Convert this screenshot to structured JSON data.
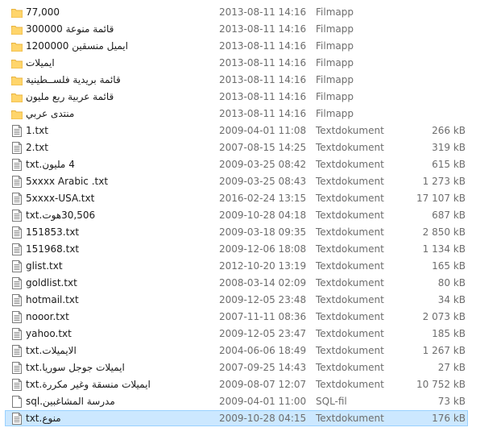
{
  "files": [
    {
      "name": "77,000",
      "date": "2013-08-11 14:16",
      "type": "Filmapp",
      "size": "",
      "icon": "folder-icon"
    },
    {
      "name": "قائمة منوعة 300000",
      "date": "2013-08-11 14:16",
      "type": "Filmapp",
      "size": "",
      "icon": "folder-icon"
    },
    {
      "name": "ايميل منسقين 1200000",
      "date": "2013-08-11 14:16",
      "type": "Filmapp",
      "size": "",
      "icon": "folder-icon"
    },
    {
      "name": "ايميلات",
      "date": "2013-08-11 14:16",
      "type": "Filmapp",
      "size": "",
      "icon": "folder-icon"
    },
    {
      "name": "قائمة بريدية فلســطينية",
      "date": "2013-08-11 14:16",
      "type": "Filmapp",
      "size": "",
      "icon": "folder-icon"
    },
    {
      "name": "قائمة عربية ربع مليون",
      "date": "2013-08-11 14:16",
      "type": "Filmapp",
      "size": "",
      "icon": "folder-icon"
    },
    {
      "name": "منتدى عربي",
      "date": "2013-08-11 14:16",
      "type": "Filmapp",
      "size": "",
      "icon": "folder-icon"
    },
    {
      "name": "1.txt",
      "date": "2009-04-01 11:08",
      "type": "Textdokument",
      "size": "266 kB",
      "icon": "text-file-icon"
    },
    {
      "name": "2.txt",
      "date": "2007-08-15 14:25",
      "type": "Textdokument",
      "size": "319 kB",
      "icon": "text-file-icon"
    },
    {
      "name": "4 مليون.txt",
      "date": "2009-03-25 08:42",
      "type": "Textdokument",
      "size": "615 kB",
      "icon": "text-file-icon"
    },
    {
      "name": "5xxxx Arabic .txt",
      "date": "2009-03-25 08:43",
      "type": "Textdokument",
      "size": "1 273 kB",
      "icon": "text-file-icon"
    },
    {
      "name": "5xxxx-USA.txt",
      "date": "2016-02-24 13:15",
      "type": "Textdokument",
      "size": "17 107 kB",
      "icon": "text-file-icon"
    },
    {
      "name": "30,506هوت.txt",
      "date": "2009-10-28 04:18",
      "type": "Textdokument",
      "size": "687 kB",
      "icon": "text-file-icon"
    },
    {
      "name": "151853.txt",
      "date": "2009-03-18 09:35",
      "type": "Textdokument",
      "size": "2 850 kB",
      "icon": "text-file-icon"
    },
    {
      "name": "151968.txt",
      "date": "2009-12-06 18:08",
      "type": "Textdokument",
      "size": "1 134 kB",
      "icon": "text-file-icon"
    },
    {
      "name": "glist.txt",
      "date": "2012-10-20 13:19",
      "type": "Textdokument",
      "size": "165 kB",
      "icon": "text-file-icon"
    },
    {
      "name": "goldlist.txt",
      "date": "2008-03-14 02:09",
      "type": "Textdokument",
      "size": "80 kB",
      "icon": "text-file-icon"
    },
    {
      "name": "hotmail.txt",
      "date": "2009-12-05 23:48",
      "type": "Textdokument",
      "size": "34 kB",
      "icon": "text-file-icon"
    },
    {
      "name": "nooor.txt",
      "date": "2007-11-11 08:36",
      "type": "Textdokument",
      "size": "2 073 kB",
      "icon": "text-file-icon"
    },
    {
      "name": "yahoo.txt",
      "date": "2009-12-05 23:47",
      "type": "Textdokument",
      "size": "185 kB",
      "icon": "text-file-icon"
    },
    {
      "name": "الايميلات.txt",
      "date": "2004-06-06 18:49",
      "type": "Textdokument",
      "size": "1 267 kB",
      "icon": "text-file-icon"
    },
    {
      "name": "ايميلات جوجل سوريا.txt",
      "date": "2007-09-25 14:43",
      "type": "Textdokument",
      "size": "27 kB",
      "icon": "text-file-icon"
    },
    {
      "name": "ايميلات منسقة وغير مكررة.txt",
      "date": "2009-08-07 12:07",
      "type": "Textdokument",
      "size": "10 752 kB",
      "icon": "text-file-icon"
    },
    {
      "name": "مدرسة المشاغبين.sql",
      "date": "2009-04-01 11:00",
      "type": "SQL-fil",
      "size": "73 kB",
      "icon": "sql-file-icon"
    },
    {
      "name": "منوع.txt",
      "date": "2009-10-28 04:15",
      "type": "Textdokument",
      "size": "176 kB",
      "icon": "text-file-icon",
      "selected": true
    }
  ],
  "colors": {
    "folder": "#ffd56b",
    "folder_dark": "#e8b23c",
    "selection_bg": "#cce8ff",
    "selection_border": "#99d1ff"
  }
}
